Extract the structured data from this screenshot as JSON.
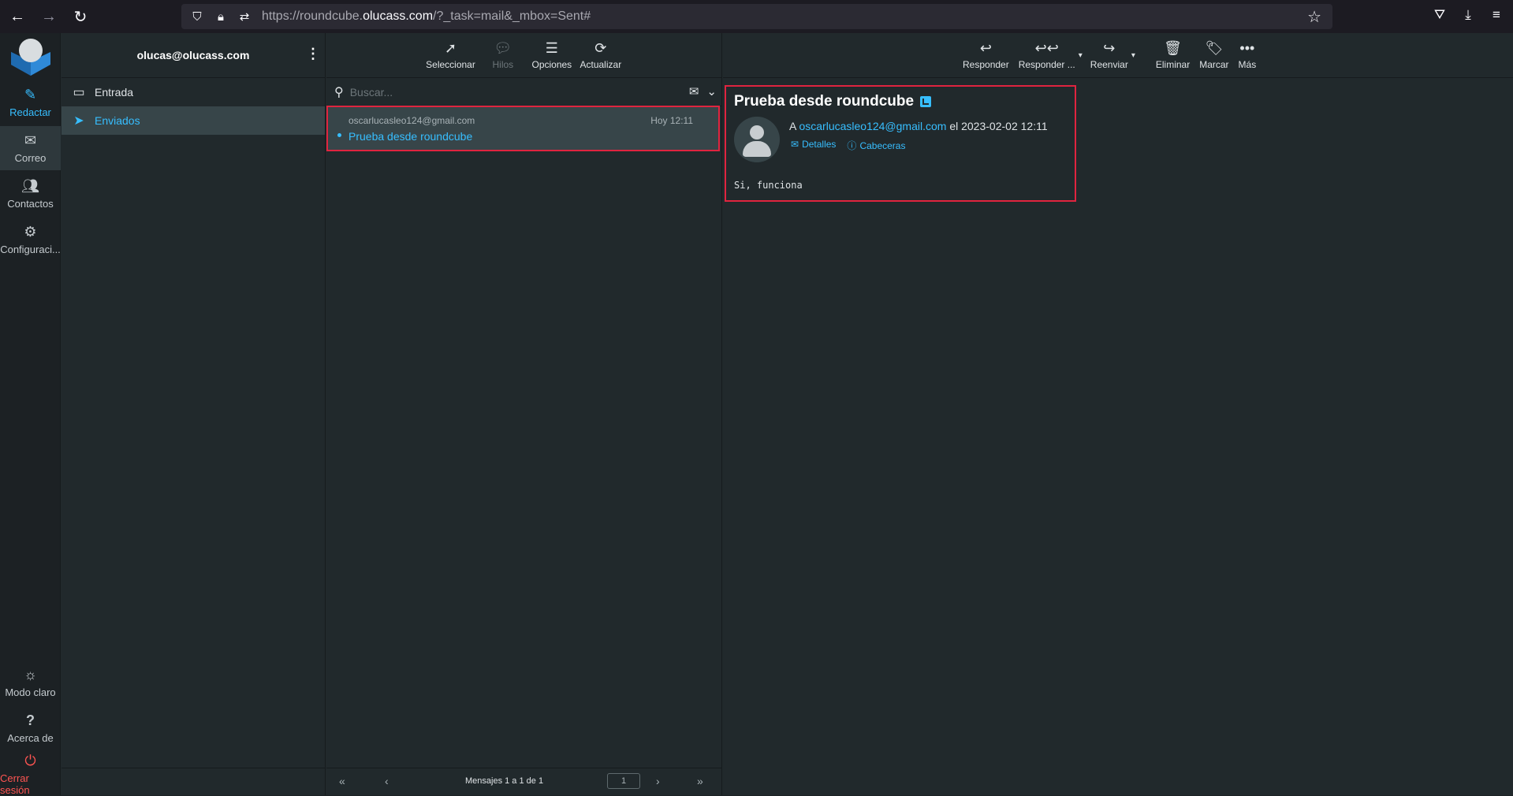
{
  "browser": {
    "url_prefix": "https://roundcube.",
    "url_domain": "olucass.com",
    "url_suffix": "/?_task=mail&_mbox=Sent#"
  },
  "taskbar": {
    "compose": "Redactar",
    "mail": "Correo",
    "contacts": "Contactos",
    "settings": "Configuraci...",
    "light_mode": "Modo claro",
    "about": "Acerca de",
    "logout": "Cerrar sesión"
  },
  "folders": {
    "account": "olucas@olucass.com",
    "items": [
      {
        "label": "Entrada"
      },
      {
        "label": "Enviados"
      }
    ]
  },
  "message_list": {
    "toolbar": {
      "select": "Seleccionar",
      "threads": "Hilos",
      "options": "Opciones",
      "refresh": "Actualizar"
    },
    "search_placeholder": "Buscar...",
    "rows": [
      {
        "from": "oscarlucasleo124@gmail.com",
        "date": "Hoy 12:11",
        "subject": "Prueba desde roundcube"
      }
    ],
    "pager": {
      "count": "Mensajes 1 a 1 de 1",
      "page": "1"
    }
  },
  "preview": {
    "toolbar": {
      "reply": "Responder",
      "reply_all": "Responder ...",
      "forward": "Reenviar",
      "delete": "Eliminar",
      "mark": "Marcar",
      "more": "Más"
    },
    "subject": "Prueba desde roundcube",
    "to_prefix": "A",
    "to_address": "oscarlucasleo124@gmail.com",
    "date_text": "el 2023-02-02 12:11",
    "details": "Detalles",
    "headers": "Cabeceras",
    "body": "Si, funciona"
  }
}
